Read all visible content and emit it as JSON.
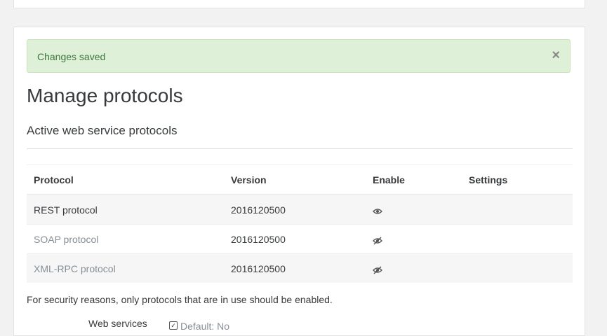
{
  "alert": {
    "message": "Changes saved",
    "close_symbol": "×"
  },
  "page": {
    "title": "Manage protocols",
    "section_title": "Active web service protocols"
  },
  "table": {
    "headers": [
      "Protocol",
      "Version",
      "Enable",
      "Settings"
    ],
    "rows": [
      {
        "protocol": "REST protocol",
        "version": "2016120500",
        "enabled": true,
        "icon": "eye-icon"
      },
      {
        "protocol": "SOAP protocol",
        "version": "2016120500",
        "enabled": false,
        "icon": "eye-slash-icon"
      },
      {
        "protocol": "XML-RPC protocol",
        "version": "2016120500",
        "enabled": false,
        "icon": "eye-slash-icon"
      }
    ]
  },
  "note": "For security reasons, only protocols that are in use should be enabled.",
  "web_services": {
    "label": "Web services",
    "default_text": "Default: No"
  },
  "colors": {
    "alert_bg": "#dff0d8",
    "alert_text": "#3c763d",
    "disabled_text": "#868e96"
  }
}
